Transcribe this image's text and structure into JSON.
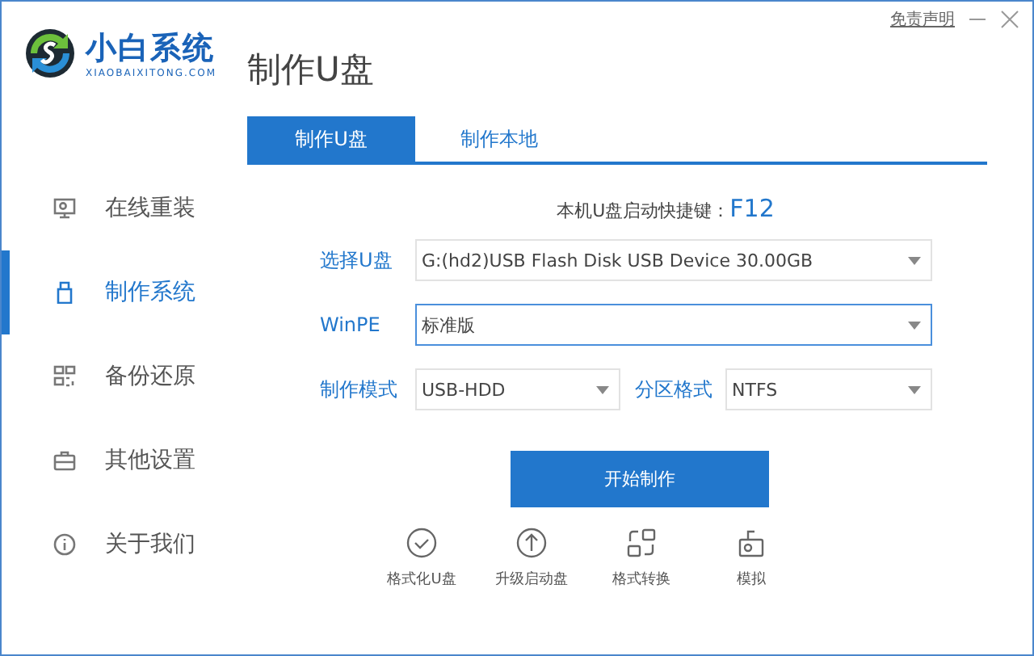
{
  "logo": {
    "name": "小白系统",
    "domain": "XIAOBAIXITONG.COM"
  },
  "disclaimer": "免责声明",
  "page_title": "制作U盘",
  "nav": [
    {
      "label": "在线重装",
      "selected": false
    },
    {
      "label": "制作系统",
      "selected": true
    },
    {
      "label": "备份还原",
      "selected": false
    },
    {
      "label": "其他设置",
      "selected": false
    },
    {
      "label": "关于我们",
      "selected": false
    }
  ],
  "tabs": [
    {
      "label": "制作U盘",
      "selected": true
    },
    {
      "label": "制作本地",
      "selected": false
    }
  ],
  "hint": {
    "text": "本机U盘启动快捷键：",
    "key": "F12"
  },
  "fields": [
    {
      "label": "选择U盘",
      "value": "G:(hd2)USB Flash Disk USB Device 30.00GB",
      "focused": false
    },
    {
      "label": "WinPE",
      "value": "标准版",
      "focused": true
    },
    {
      "label": "制作模式",
      "value": "USB-HDD",
      "focused": false
    },
    {
      "label": "分区格式",
      "value": "NTFS",
      "focused": false
    }
  ],
  "start_button": "开始制作",
  "tools": [
    {
      "label": "格式化U盘"
    },
    {
      "label": "升级启动盘"
    },
    {
      "label": "格式转换"
    },
    {
      "label": "模拟"
    }
  ]
}
